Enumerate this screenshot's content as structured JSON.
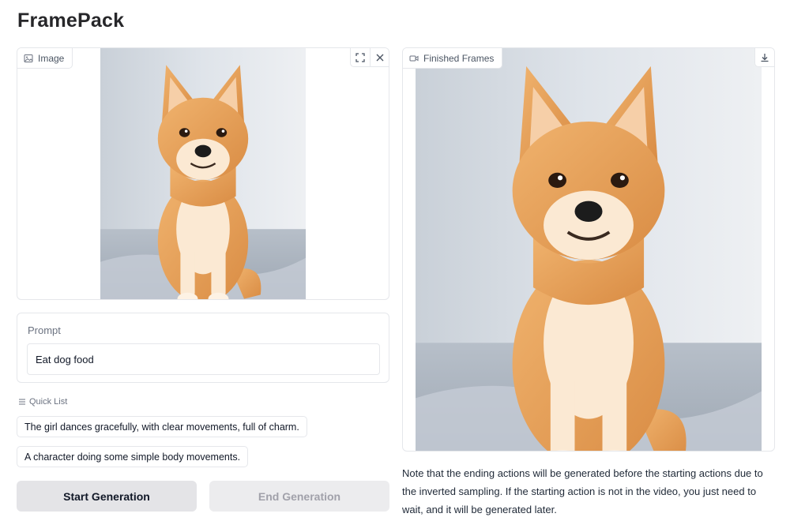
{
  "app": {
    "title": "FramePack"
  },
  "image_input": {
    "label": "Image",
    "label_icon": "image-icon",
    "tools": [
      "fullscreen-icon",
      "close-icon"
    ]
  },
  "prompt": {
    "label": "Prompt",
    "value": "Eat dog food"
  },
  "quick_list": {
    "label": "Quick List",
    "samples": [
      "The girl dances gracefully, with clear movements, full of charm.",
      "A character doing some simple body movements."
    ]
  },
  "buttons": {
    "start_label": "Start Generation",
    "end_label": "End Generation"
  },
  "output_video": {
    "label": "Finished Frames",
    "label_icon": "video-icon",
    "tools": [
      "download-icon"
    ]
  },
  "note": "Note that the ending actions will be generated before the starting actions due to the inverted sampling. If the starting action is not in the video, you just need to wait, and it will be generated later.",
  "colors": {
    "dog_fur": "#e9a15c",
    "dog_light": "#fbe9d3",
    "background": "#dde2e8",
    "button_primary": "#e4e4e7",
    "button_disabled_text": "#a1a1aa"
  }
}
